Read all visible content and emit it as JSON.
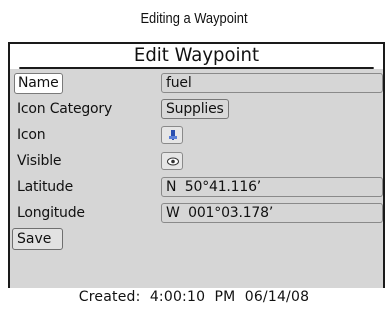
{
  "page": {
    "title": "Editing a Waypoint"
  },
  "dialog": {
    "header": "Edit Waypoint"
  },
  "fields": {
    "name": {
      "label": "Name",
      "value": "fuel"
    },
    "icon_category": {
      "label": "Icon Category",
      "value": "Supplies"
    },
    "icon": {
      "label": "Icon",
      "icon_name": "waypoint-pin-icon"
    },
    "visible": {
      "label": "Visible",
      "icon_name": "eye-icon"
    },
    "latitude": {
      "label": "Latitude",
      "value": "N  50°41.116’"
    },
    "longitude": {
      "label": "Longitude",
      "value": "W  001°03.178’"
    }
  },
  "actions": {
    "save_label": "Save"
  },
  "footer": {
    "created": "Created:  4:00:10  PM  06/14/08"
  },
  "colors": {
    "panel_bg": "#d6d6d6",
    "border": "#1a1a1a",
    "pin_blue": "#2a4fb0"
  }
}
